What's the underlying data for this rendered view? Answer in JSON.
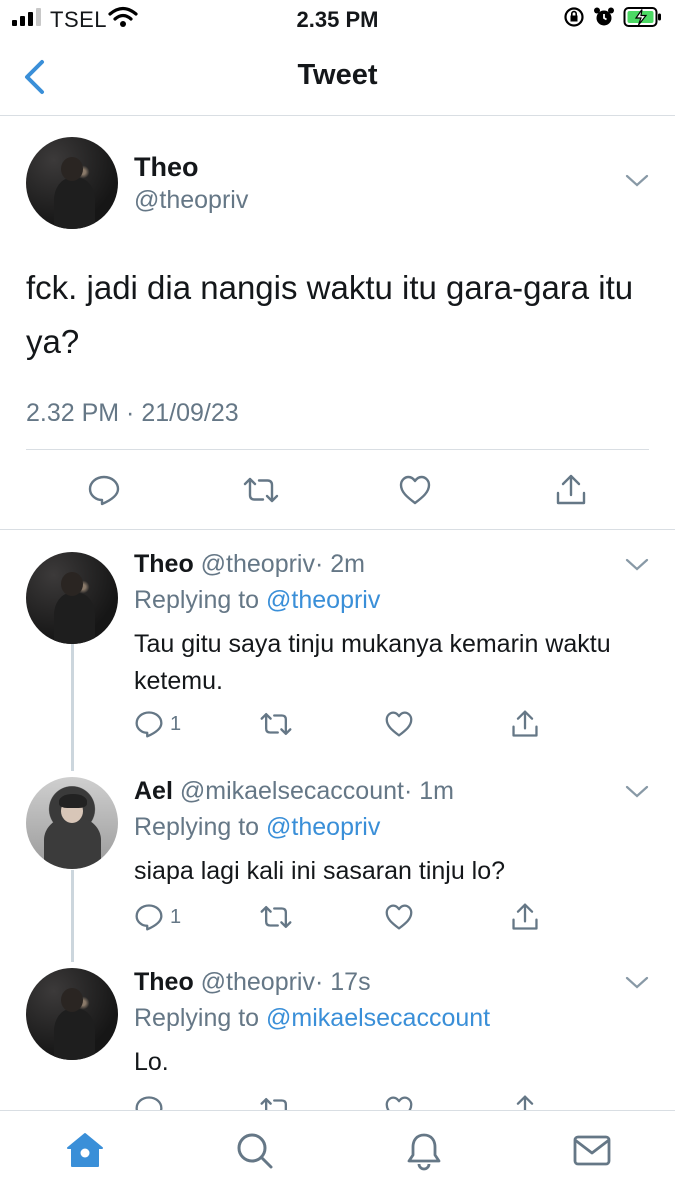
{
  "status_bar": {
    "carrier": "TSEL",
    "time": "2.35 PM"
  },
  "header": {
    "title": "Tweet"
  },
  "main_tweet": {
    "name": "Theo",
    "handle": "@theopriv",
    "text": "fck. jadi dia nangis waktu itu gara-gara itu ya?",
    "timestamp": "2.32 PM · 21/09/23"
  },
  "replies": [
    {
      "name": "Theo",
      "handle": "@theopriv",
      "time": "· 2m",
      "replying_label": "Replying to",
      "replying_to": "@theopriv",
      "text": "Tau gitu saya tinju mukanya kemarin waktu ketemu.",
      "reply_count": "1"
    },
    {
      "name": "Ael",
      "handle": "@mikaelsecaccount",
      "time": "· 1m",
      "replying_label": "Replying to",
      "replying_to": "@theopriv",
      "text": "siapa lagi kali ini sasaran tinju lo?",
      "reply_count": "1"
    },
    {
      "name": "Theo",
      "handle": "@theopriv",
      "time": "· 17s",
      "replying_label": "Replying to",
      "replying_to": "@mikaelsecaccount",
      "text": "Lo."
    }
  ],
  "tabs": [
    "home",
    "search",
    "notifications",
    "messages"
  ],
  "colors": {
    "accent": "#3a8fd8",
    "secondary_text": "#657786",
    "divider": "#d9dee3",
    "battery_green": "#4cd964"
  }
}
